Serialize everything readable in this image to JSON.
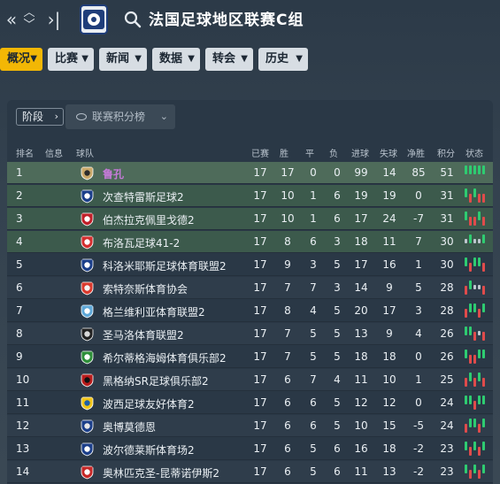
{
  "header": {
    "title": "法国足球地区联赛C组"
  },
  "tabs": [
    {
      "label": "概况",
      "active": true
    },
    {
      "label": "比赛"
    },
    {
      "label": "新闻"
    },
    {
      "label": "数据"
    },
    {
      "label": "转会"
    },
    {
      "label": "历史"
    }
  ],
  "subbar": {
    "stage_label": "阶段",
    "view_label": "联赛积分榜"
  },
  "columns": [
    "排名",
    "信息",
    "球队",
    "已赛",
    "胜",
    "平",
    "负",
    "进球",
    "失球",
    "净胜",
    "积分",
    "状态"
  ],
  "colors": {
    "accent": "#f2b705",
    "win": "#2ecc71",
    "draw": "#bfc7cf",
    "loss": "#e04b4b",
    "highlight_team": "#c57ad8"
  },
  "rows": [
    {
      "pos": "1",
      "team": "鲁孔",
      "played": "17",
      "w": "17",
      "d": "0",
      "l": "0",
      "gf": "99",
      "ga": "14",
      "gd": "85",
      "pts": "51",
      "form": [
        "W",
        "W",
        "W",
        "W",
        "W"
      ],
      "highlight": true,
      "badge": [
        "#c9a86a",
        "#2b2b2b"
      ]
    },
    {
      "pos": "2",
      "team": "次查特雷斯足球2",
      "played": "17",
      "w": "10",
      "d": "1",
      "l": "6",
      "gf": "19",
      "ga": "19",
      "gd": "0",
      "pts": "31",
      "form": [
        "W",
        "L",
        "W",
        "L",
        "L"
      ],
      "badge": [
        "#1c3f8a",
        "#ffffff"
      ]
    },
    {
      "pos": "3",
      "team": "伯杰拉克佩里戈德2",
      "played": "17",
      "w": "10",
      "d": "1",
      "l": "6",
      "gf": "17",
      "ga": "24",
      "gd": "-7",
      "pts": "31",
      "form": [
        "W",
        "L",
        "L",
        "W",
        "L"
      ],
      "badge": [
        "#c0202a",
        "#ffffff"
      ]
    },
    {
      "pos": "4",
      "team": "布洛瓦足球41-2",
      "played": "17",
      "w": "8",
      "d": "6",
      "l": "3",
      "gf": "18",
      "ga": "11",
      "gd": "7",
      "pts": "30",
      "form": [
        "D",
        "W",
        "D",
        "D",
        "W"
      ],
      "badge": [
        "#d32f2f",
        "#ffffff"
      ]
    },
    {
      "pos": "5",
      "team": "科洛米耶斯足球体育联盟2",
      "played": "17",
      "w": "9",
      "d": "3",
      "l": "5",
      "gf": "17",
      "ga": "16",
      "gd": "1",
      "pts": "30",
      "form": [
        "W",
        "L",
        "W",
        "W",
        "L"
      ],
      "badge": [
        "#1c3f8a",
        "#ffffff"
      ]
    },
    {
      "pos": "6",
      "team": "索特奈斯体育协会",
      "played": "17",
      "w": "7",
      "d": "7",
      "l": "3",
      "gf": "14",
      "ga": "9",
      "gd": "5",
      "pts": "28",
      "form": [
        "L",
        "W",
        "D",
        "D",
        "L"
      ],
      "badge": [
        "#d93a2e",
        "#f4f4f4"
      ]
    },
    {
      "pos": "7",
      "team": "格兰维利亚体育联盟2",
      "played": "17",
      "w": "8",
      "d": "4",
      "l": "5",
      "gf": "20",
      "ga": "17",
      "gd": "3",
      "pts": "28",
      "form": [
        "L",
        "W",
        "W",
        "L",
        "W"
      ],
      "badge": [
        "#5fa8d8",
        "#ffffff"
      ]
    },
    {
      "pos": "8",
      "team": "圣马洛体育联盟2",
      "played": "17",
      "w": "7",
      "d": "5",
      "l": "5",
      "gf": "13",
      "ga": "9",
      "gd": "4",
      "pts": "26",
      "form": [
        "W",
        "W",
        "L",
        "D",
        "L"
      ],
      "badge": [
        "#222222",
        "#d8d8d8"
      ]
    },
    {
      "pos": "9",
      "team": "希尔蒂格海姆体育俱乐部2",
      "played": "17",
      "w": "7",
      "d": "5",
      "l": "5",
      "gf": "18",
      "ga": "18",
      "gd": "0",
      "pts": "26",
      "form": [
        "W",
        "L",
        "L",
        "W",
        "W"
      ],
      "badge": [
        "#2f8f3a",
        "#ffffff"
      ]
    },
    {
      "pos": "10",
      "team": "黑格纳SR足球俱乐部2",
      "played": "17",
      "w": "6",
      "d": "7",
      "l": "4",
      "gf": "11",
      "ga": "10",
      "gd": "1",
      "pts": "25",
      "form": [
        "L",
        "W",
        "L",
        "W",
        "L"
      ],
      "badge": [
        "#b71c1c",
        "#111111"
      ]
    },
    {
      "pos": "11",
      "team": "波西足球友好体育2",
      "played": "17",
      "w": "6",
      "d": "6",
      "l": "5",
      "gf": "12",
      "ga": "12",
      "gd": "0",
      "pts": "24",
      "form": [
        "W",
        "W",
        "L",
        "W",
        "W"
      ],
      "badge": [
        "#f0c419",
        "#1d5fa8"
      ]
    },
    {
      "pos": "12",
      "team": "奥博莫德恩",
      "played": "17",
      "w": "6",
      "d": "6",
      "l": "5",
      "gf": "10",
      "ga": "15",
      "gd": "-5",
      "pts": "24",
      "form": [
        "L",
        "W",
        "W",
        "L",
        "W"
      ],
      "badge": [
        "#1c3f8a",
        "#e6e6e6"
      ]
    },
    {
      "pos": "13",
      "team": "波尔德莱斯体育场2",
      "played": "17",
      "w": "6",
      "d": "5",
      "l": "6",
      "gf": "16",
      "ga": "18",
      "gd": "-2",
      "pts": "23",
      "form": [
        "W",
        "L",
        "W",
        "L",
        "W"
      ],
      "badge": [
        "#1c3f8a",
        "#ffffff"
      ]
    },
    {
      "pos": "14",
      "team": "奥林匹克圣-昆蒂诺伊斯2",
      "played": "17",
      "w": "6",
      "d": "5",
      "l": "6",
      "gf": "11",
      "ga": "13",
      "gd": "-2",
      "pts": "23",
      "form": [
        "W",
        "L",
        "W",
        "L",
        "W"
      ],
      "badge": [
        "#c62828",
        "#ffffff"
      ]
    }
  ]
}
